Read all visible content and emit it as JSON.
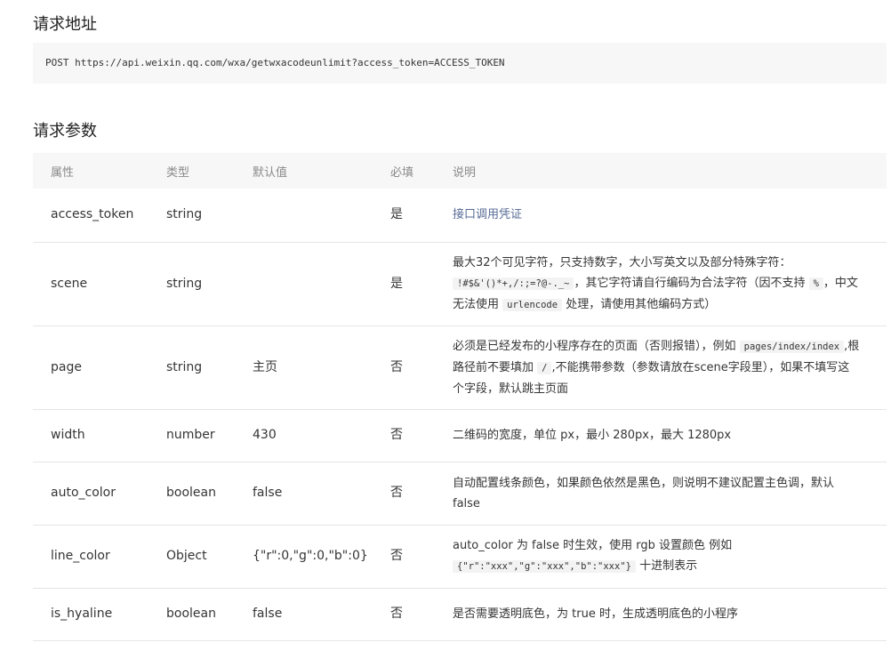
{
  "sections": {
    "url_heading": "请求地址",
    "params_heading": "请求参数"
  },
  "request_url": "POST https://api.weixin.qq.com/wxa/getwxacodeunlimit?access_token=ACCESS_TOKEN",
  "table": {
    "headers": [
      "属性",
      "类型",
      "默认值",
      "必填",
      "说明"
    ],
    "rows": [
      {
        "name": "access_token",
        "type": "string",
        "default": "",
        "required": "是",
        "desc_link": "接口调用凭证"
      },
      {
        "name": "scene",
        "type": "string",
        "default": "",
        "required": "是",
        "desc_a": "最大32个可见字符，只支持数字，大小写英文以及部分特殊字符：",
        "desc_code1": "!#$&'()*+,/:;=?@-._~",
        "desc_b": "，其它字符请自行编码为合法字符（因不支持",
        "desc_code2": "%",
        "desc_c": "，中文无法使用",
        "desc_code3": "urlencode",
        "desc_d": "处理，请使用其他编码方式）"
      },
      {
        "name": "page",
        "type": "string",
        "default": "主页",
        "required": "否",
        "desc_a": "必须是已经发布的小程序存在的页面（否则报错），例如",
        "desc_code1": "pages/index/index",
        "desc_b": ",根路径前不要填加",
        "desc_code2": "/",
        "desc_c": ",不能携带参数（参数请放在scene字段里），如果不填写这个字段，默认跳主页面"
      },
      {
        "name": "width",
        "type": "number",
        "default": "430",
        "required": "否",
        "desc": "二维码的宽度，单位 px，最小 280px，最大 1280px"
      },
      {
        "name": "auto_color",
        "type": "boolean",
        "default": "false",
        "required": "否",
        "desc": "自动配置线条颜色，如果颜色依然是黑色，则说明不建议配置主色调，默认 false"
      },
      {
        "name": "line_color",
        "type": "Object",
        "default": "{\"r\":0,\"g\":0,\"b\":0}",
        "required": "否",
        "desc_a": "auto_color 为 false 时生效，使用 rgb 设置颜色 例如",
        "desc_code1": "{\"r\":\"xxx\",\"g\":\"xxx\",\"b\":\"xxx\"}",
        "desc_b": "十进制表示"
      },
      {
        "name": "is_hyaline",
        "type": "boolean",
        "default": "false",
        "required": "否",
        "desc": "是否需要透明底色，为 true 时，生成透明底色的小程序"
      }
    ]
  }
}
